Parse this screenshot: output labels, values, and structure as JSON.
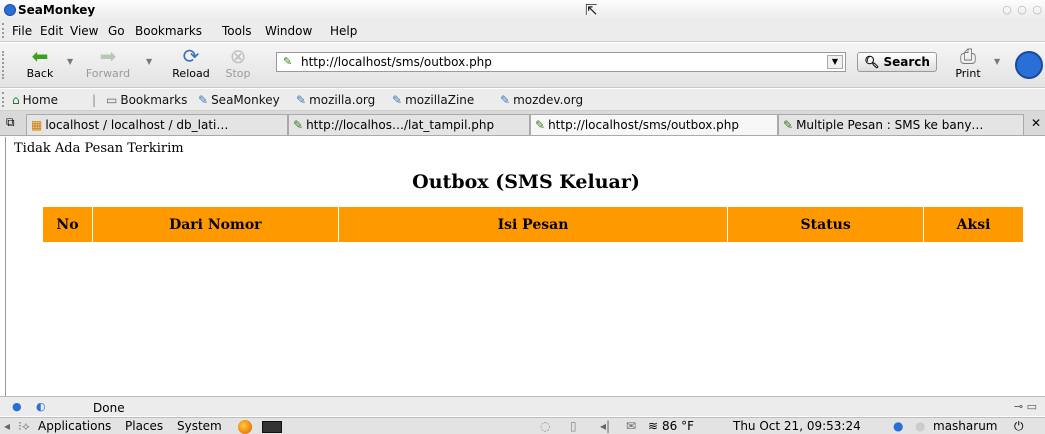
{
  "window": {
    "title": "SeaMonkey",
    "controls": "○ ○ ○"
  },
  "menubar": {
    "items": [
      "File",
      "Edit",
      "View",
      "Go",
      "Bookmarks",
      "Tools",
      "Window",
      "Help"
    ]
  },
  "nav": {
    "back": "Back",
    "forward": "Forward",
    "reload": "Reload",
    "stop": "Stop",
    "url": "http://localhost/sms/outbox.php",
    "search": "Search",
    "print": "Print"
  },
  "bookmarks": {
    "items": [
      "Home",
      "Bookmarks",
      "SeaMonkey",
      "mozilla.org",
      "mozillaZine",
      "mozdev.org"
    ]
  },
  "tabs": [
    {
      "label": "localhost / localhost / db_lati…",
      "active": false
    },
    {
      "label": "http://localhos…/lat_tampil.php",
      "active": false
    },
    {
      "label": "http://localhost/sms/outbox.php",
      "active": true
    },
    {
      "label": "Multiple Pesan : SMS ke bany…",
      "active": false
    }
  ],
  "page": {
    "notice": "Tidak Ada Pesan Terkirim",
    "title": "Outbox (SMS Keluar)",
    "columns": [
      "No",
      "Dari Nomor",
      "Isi Pesan",
      "Status",
      "Aksi"
    ],
    "header_color": "#ff9900"
  },
  "status": {
    "text": "Done"
  },
  "panel": {
    "applications": "Applications",
    "places": "Places",
    "system": "System",
    "temperature": "86 °F",
    "clock": "Thu Oct 21, 09:53:24",
    "user": "masharum"
  }
}
